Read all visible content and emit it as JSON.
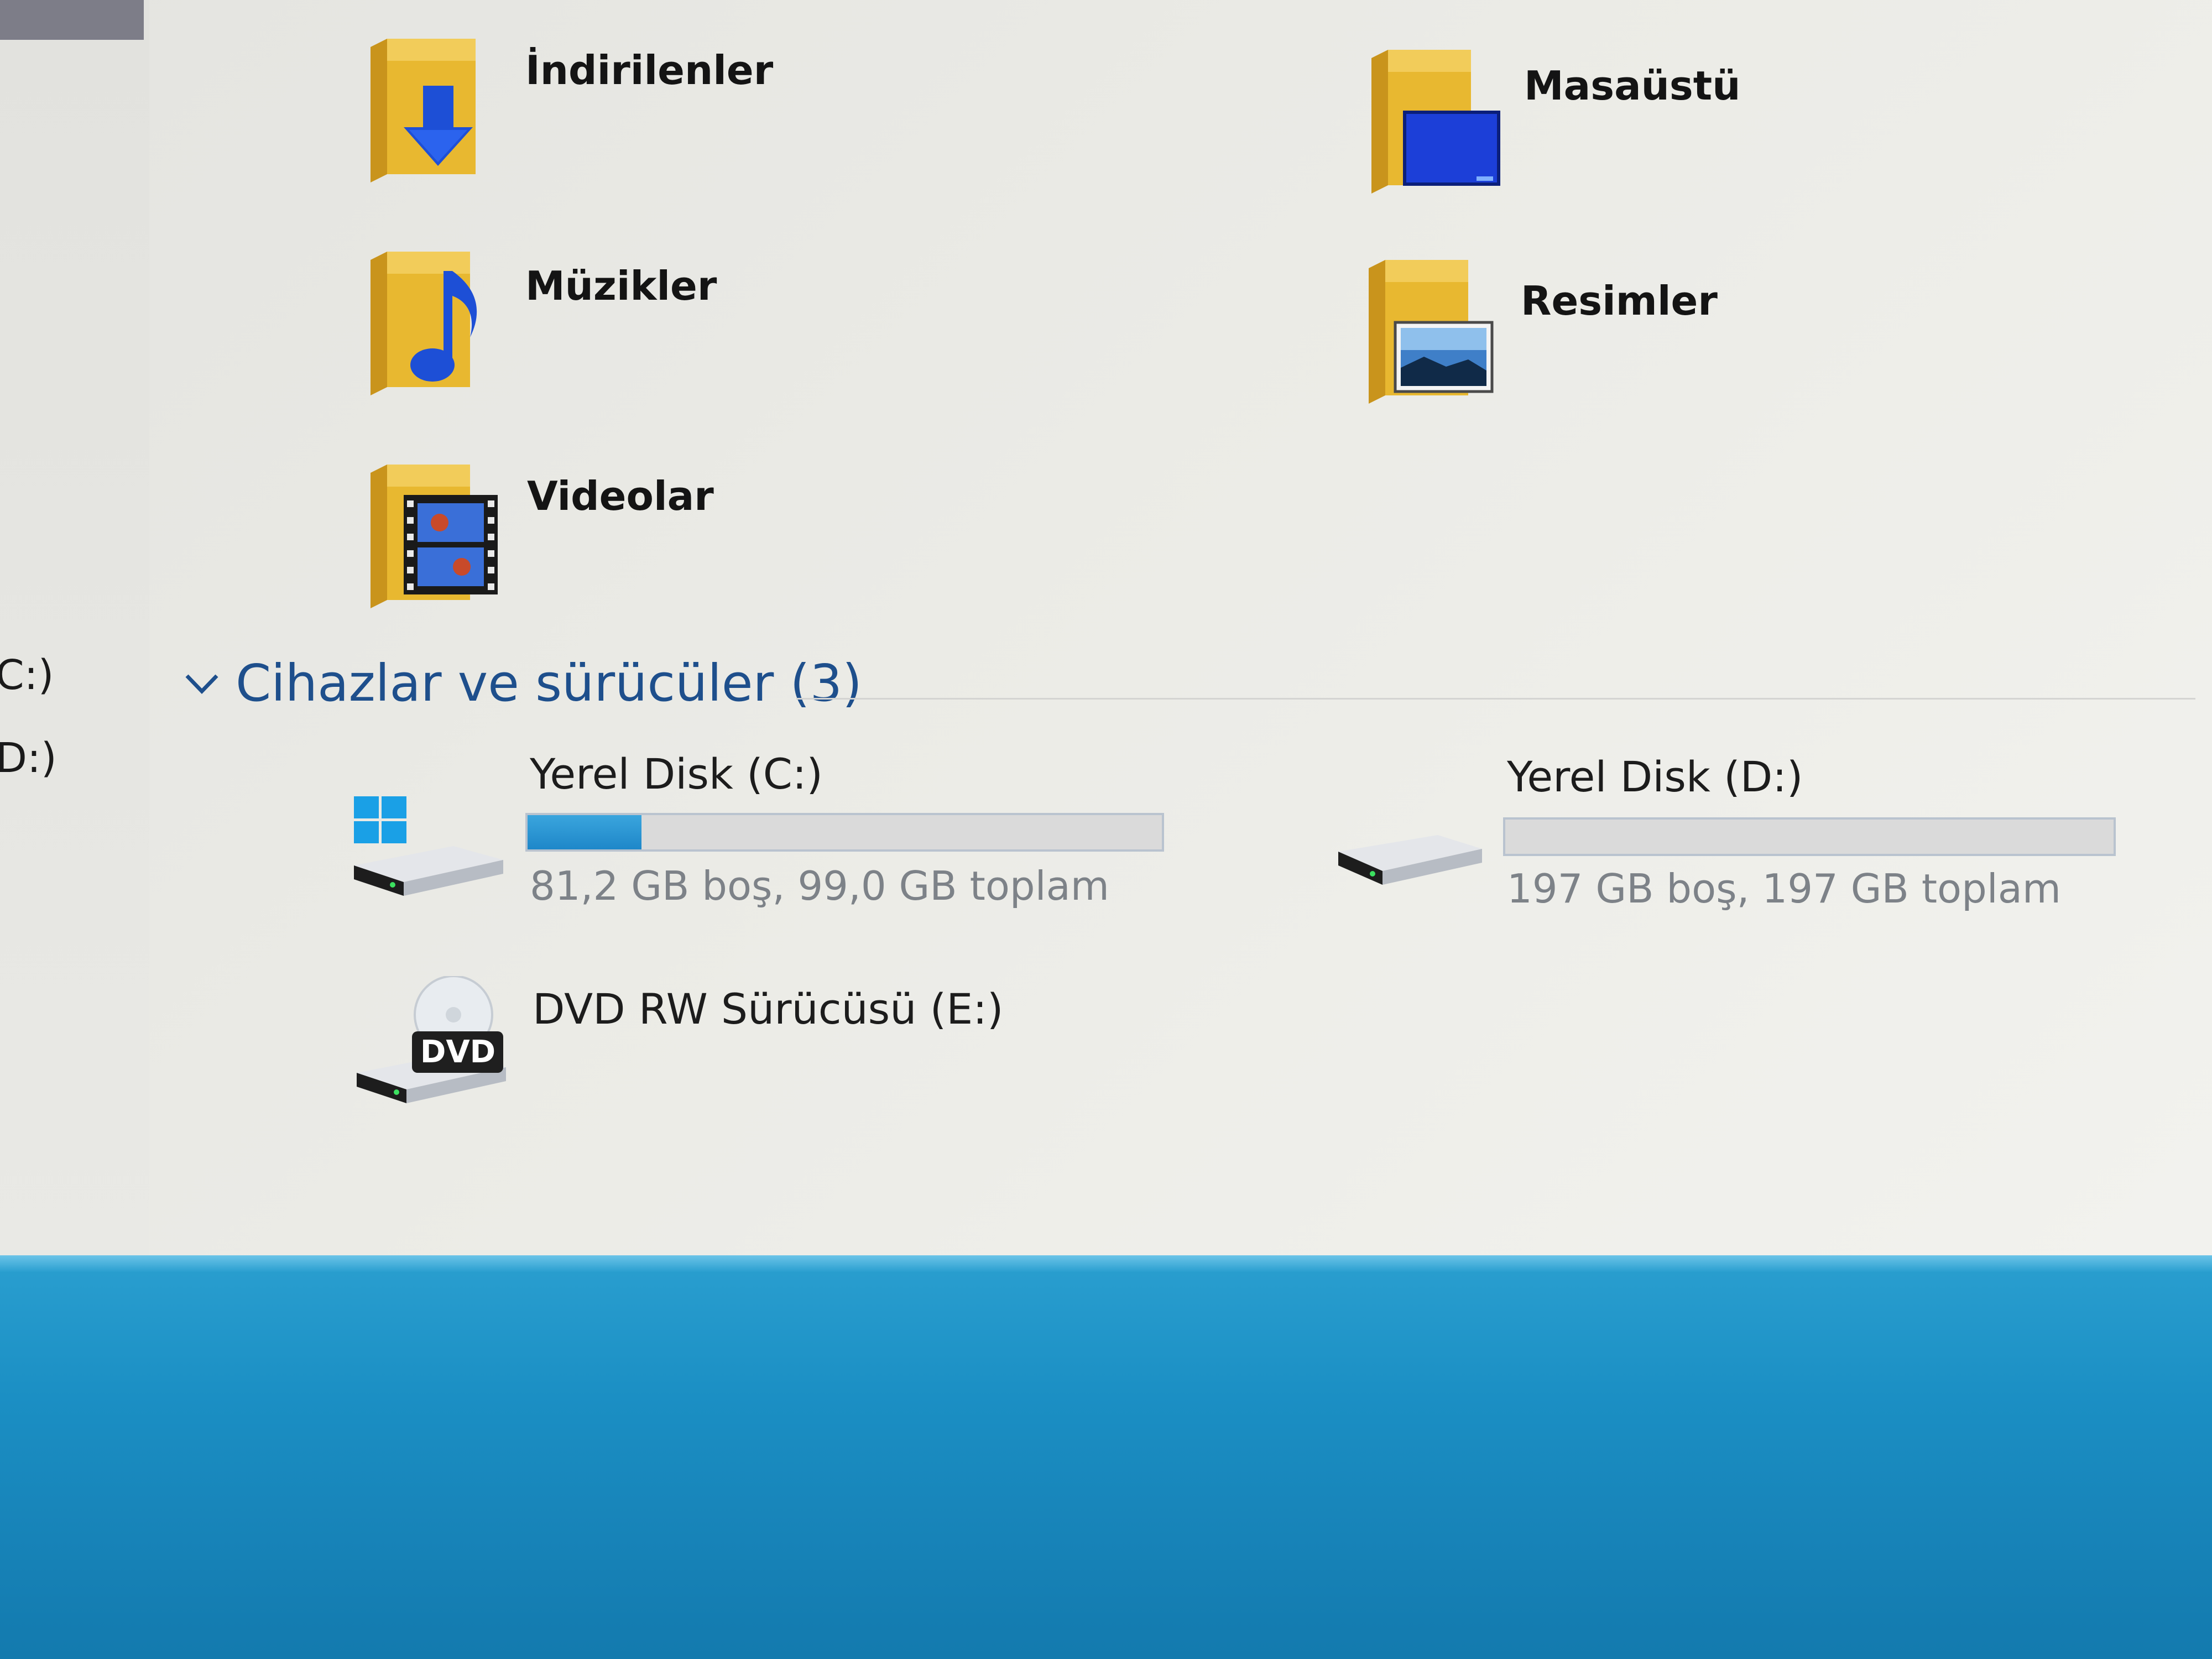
{
  "nav": {
    "drive_c": "C:)",
    "drive_d": "D:)"
  },
  "folders": [
    {
      "label": "İndirilenler",
      "icon": "downloads-folder-icon"
    },
    {
      "label": "Masaüstü",
      "icon": "desktop-folder-icon"
    },
    {
      "label": "Müzikler",
      "icon": "music-folder-icon"
    },
    {
      "label": "Resimler",
      "icon": "pictures-folder-icon"
    },
    {
      "label": "Videolar",
      "icon": "videos-folder-icon"
    }
  ],
  "devices": {
    "header": "Cihazlar ve sürücüler (3)",
    "drives": [
      {
        "name": "Yerel Disk (C:)",
        "space": "81,2 GB boş, 99,0 GB toplam",
        "used_fraction": 0.18,
        "icon": "windows-drive-icon"
      },
      {
        "name": "Yerel Disk (D:)",
        "space": "197 GB boş, 197 GB toplam",
        "used_fraction": 0.0,
        "icon": "hard-drive-icon"
      },
      {
        "name": "DVD RW Sürücüsü (E:)",
        "icon": "dvd-drive-icon",
        "badge": "DVD"
      }
    ]
  },
  "colors": {
    "accent": "#1e4f8c",
    "usage_bar": "#2596d3",
    "taskbar": "#1b8fc4",
    "folder": "#e8b830"
  }
}
